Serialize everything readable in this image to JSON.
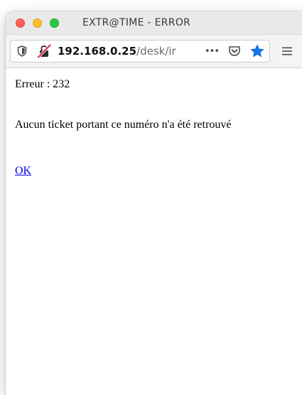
{
  "window": {
    "title": "EXTR@TIME - ERROR"
  },
  "toolbar": {
    "url_host": "192.168.0.25",
    "url_path": "/desk/ir",
    "more_label": "•••",
    "icons": [
      "shield-icon",
      "insecure-connection-icon",
      "more-icon",
      "pocket-icon",
      "bookmark-star-icon",
      "hamburger-menu-icon"
    ],
    "accent_color": "#1a73e8"
  },
  "content": {
    "error_line": "Erreur : 232",
    "message": "Aucun ticket portant ce numéro n'a été retrouvé",
    "ok_link": "OK",
    "link_color": "#0000ee"
  }
}
